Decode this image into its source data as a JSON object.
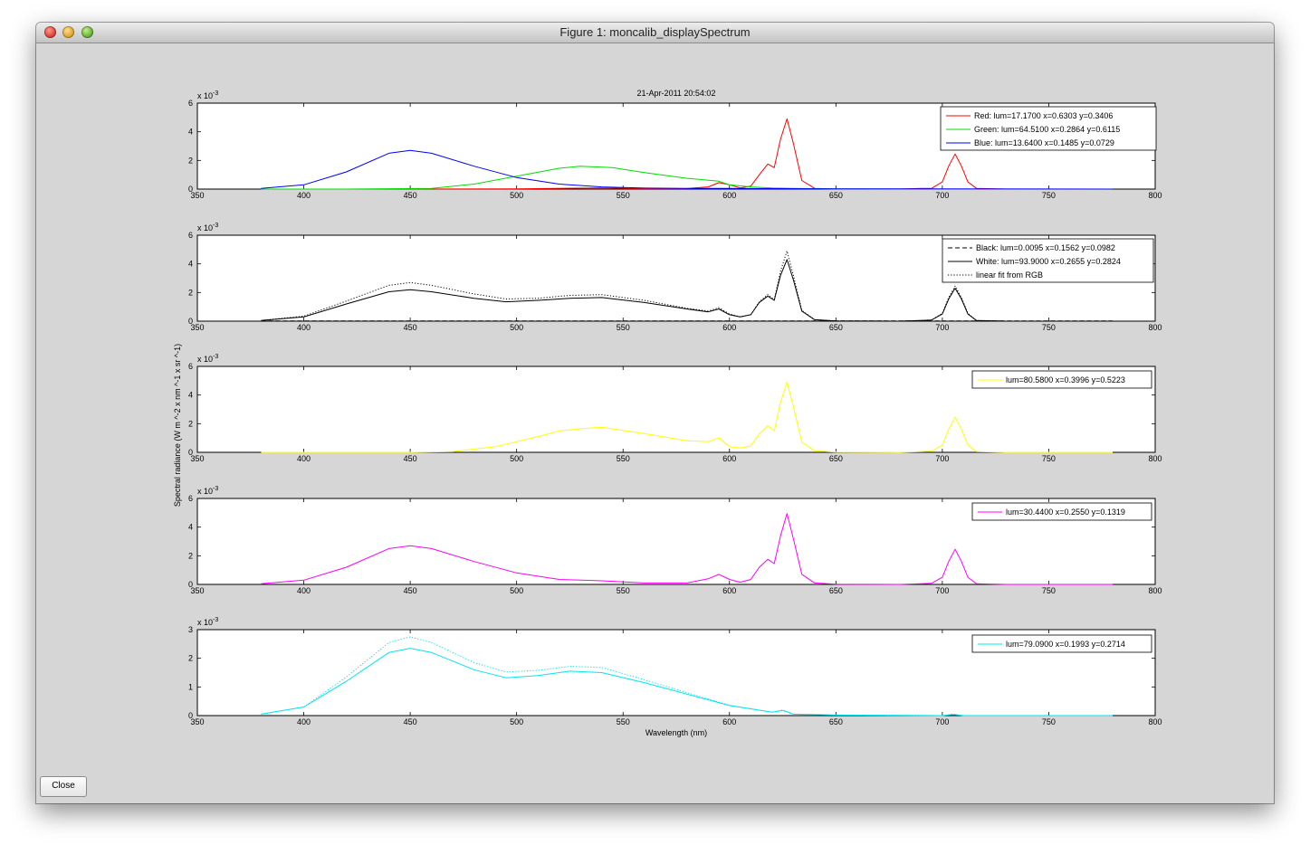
{
  "window": {
    "title": "Figure 1: moncalib_displaySpectrum",
    "close_button": "Close"
  },
  "figure": {
    "timestamp": "21-Apr-2011 20:54:02",
    "ylabel": "Spectral radiance (W m ^-2 x nm ^-1 x sr ^-1)",
    "xlabel": "Wavelength (nm)"
  },
  "chart_data": [
    {
      "type": "line",
      "title": "21-Apr-2011 20:54:02",
      "xlim": [
        350,
        800
      ],
      "ylim": [
        0,
        6
      ],
      "exponent": "x 10^-3",
      "xticks": [
        350,
        400,
        450,
        500,
        550,
        600,
        650,
        700,
        750,
        800
      ],
      "yticks": [
        0,
        2,
        4,
        6
      ],
      "legend_position": "top-right",
      "series": [
        {
          "name": "Red: lum=17.1700 x=0.6303 y=0.3406",
          "color": "#ff0000",
          "style": "solid",
          "x": [
            380,
            450,
            500,
            540,
            560,
            580,
            590,
            595,
            600,
            605,
            610,
            614,
            618,
            621,
            624,
            627,
            630,
            634,
            640,
            650,
            680,
            690,
            695,
            700,
            703,
            706,
            709,
            712,
            716,
            730,
            780
          ],
          "y": [
            0,
            0,
            0.02,
            0.08,
            0.03,
            0.04,
            0.15,
            0.45,
            0.3,
            0.08,
            0.2,
            1.0,
            1.75,
            1.5,
            3.5,
            4.9,
            3.2,
            0.6,
            0.05,
            0,
            0,
            0.05,
            0.05,
            0.5,
            1.6,
            2.45,
            1.6,
            0.5,
            0.05,
            0,
            0
          ]
        },
        {
          "name": "Green: lum=64.5100 x=0.2864 y=0.6115",
          "color": "#00dd00",
          "style": "solid",
          "x": [
            380,
            420,
            460,
            480,
            500,
            520,
            530,
            545,
            560,
            580,
            595,
            600,
            610,
            620,
            630,
            650,
            700,
            780
          ],
          "y": [
            0,
            0,
            0.05,
            0.35,
            0.9,
            1.45,
            1.6,
            1.5,
            1.15,
            0.75,
            0.55,
            0.3,
            0.15,
            0.08,
            0.05,
            0.02,
            0,
            0
          ]
        },
        {
          "name": "Blue: lum=13.6400 x=0.1485 y=0.0729",
          "color": "#0000ff",
          "style": "solid",
          "x": [
            380,
            400,
            420,
            440,
            450,
            460,
            480,
            500,
            520,
            540,
            560,
            580,
            600,
            620,
            650,
            780
          ],
          "y": [
            0.05,
            0.3,
            1.2,
            2.5,
            2.7,
            2.5,
            1.6,
            0.8,
            0.35,
            0.15,
            0.07,
            0.05,
            0.05,
            0.03,
            0.02,
            0
          ]
        }
      ]
    },
    {
      "type": "line",
      "xlim": [
        350,
        800
      ],
      "ylim": [
        0,
        6
      ],
      "exponent": "x 10^-3",
      "xticks": [
        350,
        400,
        450,
        500,
        550,
        600,
        650,
        700,
        750,
        800
      ],
      "yticks": [
        0,
        2,
        4,
        6
      ],
      "legend_position": "top-right",
      "series": [
        {
          "name": "Black: lum=0.0095 x=0.1562 y=0.0982",
          "color": "#000000",
          "style": "dashed",
          "x": [
            380,
            780
          ],
          "y": [
            0.01,
            0.01
          ]
        },
        {
          "name": "White: lum=93.9000 x=0.2655 y=0.2824",
          "color": "#000000",
          "style": "solid",
          "x": [
            380,
            400,
            420,
            440,
            450,
            460,
            480,
            495,
            510,
            525,
            540,
            560,
            580,
            590,
            595,
            600,
            605,
            610,
            614,
            618,
            621,
            624,
            627,
            630,
            634,
            640,
            650,
            680,
            690,
            695,
            700,
            703,
            706,
            709,
            712,
            716,
            730,
            780
          ],
          "y": [
            0.05,
            0.3,
            1.2,
            2.05,
            2.2,
            2.05,
            1.6,
            1.35,
            1.45,
            1.6,
            1.65,
            1.3,
            0.85,
            0.65,
            0.85,
            0.45,
            0.3,
            0.45,
            1.3,
            1.75,
            1.45,
            3.2,
            4.3,
            2.9,
            0.7,
            0.1,
            0.02,
            0,
            0.05,
            0.08,
            0.5,
            1.55,
            2.3,
            1.55,
            0.5,
            0.05,
            0,
            0
          ]
        },
        {
          "name": "linear fit from RGB",
          "color": "#000000",
          "style": "dotted",
          "x": [
            380,
            400,
            420,
            440,
            450,
            460,
            480,
            495,
            510,
            525,
            540,
            560,
            580,
            590,
            595,
            600,
            605,
            610,
            614,
            618,
            621,
            624,
            627,
            630,
            634,
            640,
            650,
            680,
            690,
            695,
            700,
            703,
            706,
            709,
            712,
            716,
            730,
            780
          ],
          "y": [
            0.05,
            0.35,
            1.4,
            2.5,
            2.7,
            2.5,
            1.9,
            1.55,
            1.6,
            1.8,
            1.85,
            1.45,
            0.9,
            0.7,
            0.95,
            0.5,
            0.3,
            0.45,
            1.35,
            1.85,
            1.5,
            3.5,
            4.9,
            3.2,
            0.75,
            0.1,
            0.02,
            0,
            0.05,
            0.08,
            0.55,
            1.65,
            2.45,
            1.65,
            0.55,
            0.05,
            0,
            0
          ]
        }
      ]
    },
    {
      "type": "line",
      "xlim": [
        350,
        800
      ],
      "ylim": [
        0,
        6
      ],
      "exponent": "x 10^-3",
      "xticks": [
        350,
        400,
        450,
        500,
        550,
        600,
        650,
        700,
        750,
        800
      ],
      "yticks": [
        0,
        2,
        4,
        6
      ],
      "legend_position": "top-right",
      "series": [
        {
          "name": "lum=80.5800 x=0.3996 y=0.5223",
          "color": "#ffff00",
          "style": "solid",
          "x": [
            380,
            450,
            470,
            490,
            510,
            520,
            530,
            540,
            560,
            580,
            590,
            595,
            600,
            605,
            610,
            614,
            618,
            621,
            624,
            627,
            630,
            634,
            640,
            650,
            680,
            690,
            695,
            700,
            703,
            706,
            709,
            712,
            716,
            730,
            780
          ],
          "y": [
            0,
            0,
            0.05,
            0.4,
            1.1,
            1.5,
            1.65,
            1.75,
            1.3,
            0.8,
            0.75,
            1.0,
            0.4,
            0.3,
            0.45,
            1.3,
            1.85,
            1.5,
            3.5,
            4.9,
            3.2,
            0.7,
            0.1,
            0.02,
            0,
            0.05,
            0.08,
            0.5,
            1.6,
            2.45,
            1.6,
            0.5,
            0.05,
            0,
            0
          ]
        }
      ]
    },
    {
      "type": "line",
      "xlim": [
        350,
        800
      ],
      "ylim": [
        0,
        6
      ],
      "exponent": "x 10^-3",
      "xticks": [
        350,
        400,
        450,
        500,
        550,
        600,
        650,
        700,
        750,
        800
      ],
      "yticks": [
        0,
        2,
        4,
        6
      ],
      "legend_position": "top-right",
      "series": [
        {
          "name": "lum=30.4400 x=0.2550 y=0.1319",
          "color": "#ff00ff",
          "style": "solid",
          "x": [
            380,
            400,
            420,
            440,
            450,
            460,
            480,
            500,
            520,
            540,
            560,
            580,
            590,
            595,
            600,
            605,
            610,
            614,
            618,
            621,
            624,
            627,
            630,
            634,
            640,
            650,
            680,
            690,
            695,
            700,
            703,
            706,
            709,
            712,
            716,
            730,
            780
          ],
          "y": [
            0.05,
            0.3,
            1.2,
            2.5,
            2.7,
            2.5,
            1.6,
            0.8,
            0.35,
            0.25,
            0.1,
            0.1,
            0.4,
            0.7,
            0.35,
            0.15,
            0.35,
            1.2,
            1.75,
            1.45,
            3.4,
            4.95,
            3.2,
            0.7,
            0.1,
            0.02,
            0,
            0.05,
            0.08,
            0.5,
            1.6,
            2.45,
            1.6,
            0.5,
            0.05,
            0,
            0
          ]
        }
      ]
    },
    {
      "type": "line",
      "xlim": [
        350,
        800
      ],
      "ylim": [
        0,
        3
      ],
      "exponent": "x 10^-3",
      "xticks": [
        350,
        400,
        450,
        500,
        550,
        600,
        650,
        700,
        750,
        800
      ],
      "yticks": [
        0,
        1,
        2,
        3
      ],
      "legend_position": "top-right",
      "series": [
        {
          "name": "lum=79.0900 x=0.1993 y=0.2714",
          "color": "#00e5ee",
          "style": "solid",
          "x": [
            380,
            400,
            420,
            440,
            450,
            460,
            480,
            495,
            510,
            525,
            540,
            560,
            580,
            600,
            620,
            625,
            630,
            650,
            700,
            705,
            710,
            780
          ],
          "y": [
            0.05,
            0.3,
            1.2,
            2.2,
            2.35,
            2.2,
            1.6,
            1.32,
            1.4,
            1.55,
            1.5,
            1.15,
            0.75,
            0.35,
            0.12,
            0.18,
            0.05,
            0.02,
            0,
            0.04,
            0,
            0
          ]
        },
        {
          "name": "",
          "color": "#00e5ee",
          "style": "dotted",
          "x": [
            380,
            400,
            420,
            440,
            450,
            460,
            480,
            495,
            510,
            525,
            540,
            560,
            580,
            600,
            620,
            625,
            630,
            650,
            700,
            705,
            710,
            780
          ],
          "y": [
            0.05,
            0.3,
            1.35,
            2.55,
            2.75,
            2.55,
            1.85,
            1.52,
            1.58,
            1.72,
            1.68,
            1.25,
            0.8,
            0.36,
            0.12,
            0.2,
            0.05,
            0.02,
            0,
            0.05,
            0,
            0
          ]
        }
      ]
    }
  ]
}
